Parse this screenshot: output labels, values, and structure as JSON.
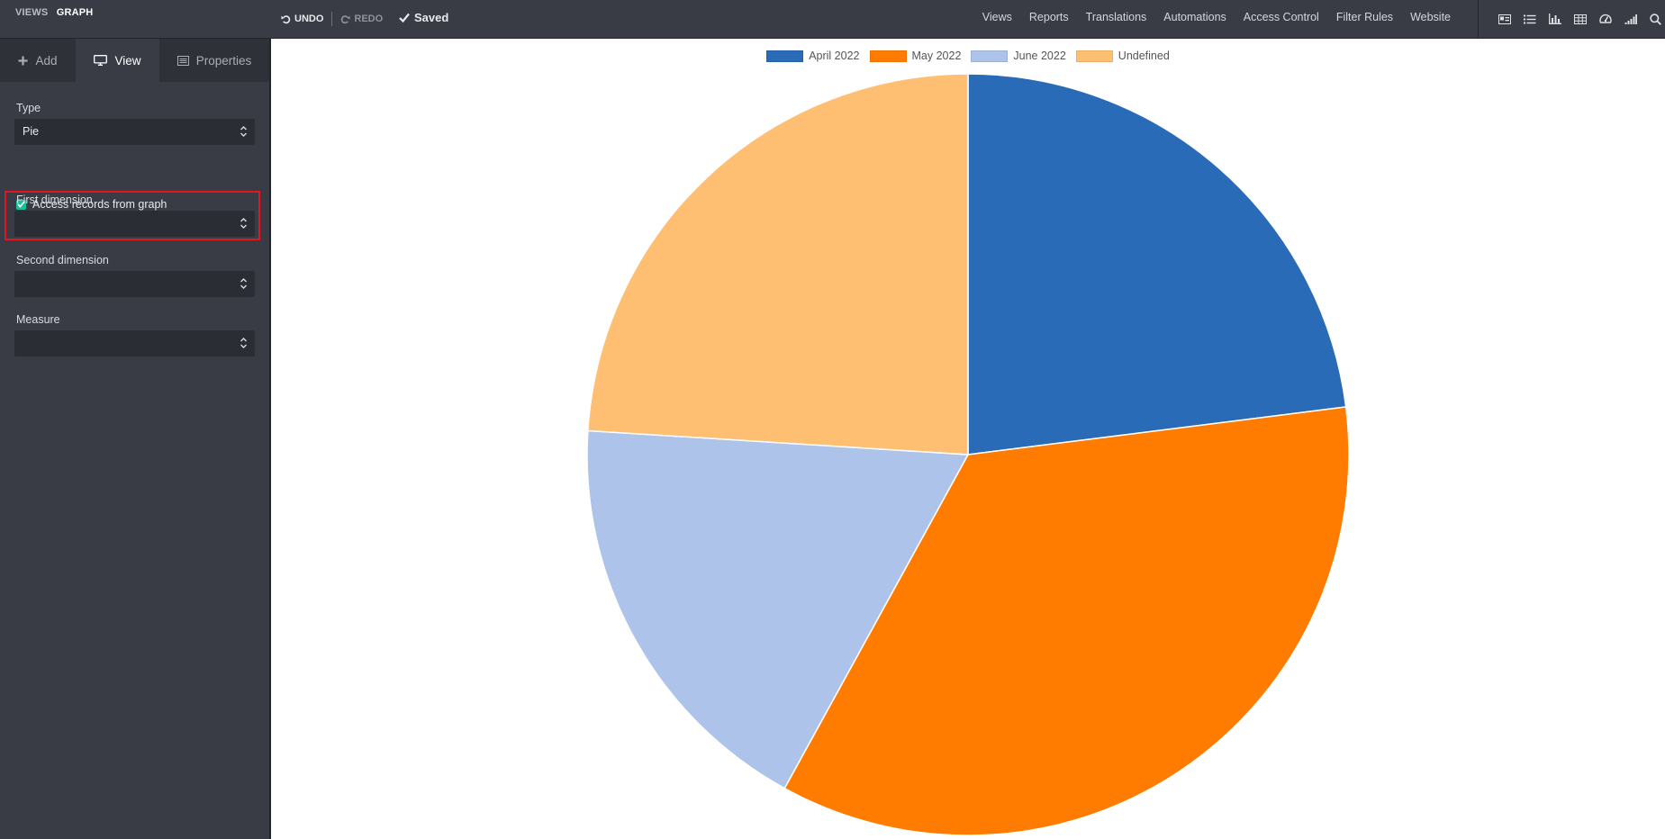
{
  "breadcrumb": {
    "views": "VIEWS",
    "current": "GRAPH"
  },
  "toolbar": {
    "undo": "UNDO",
    "redo": "REDO",
    "saved": "Saved"
  },
  "topnav": [
    "Views",
    "Reports",
    "Translations",
    "Automations",
    "Access Control",
    "Filter Rules",
    "Website"
  ],
  "view_switcher": [
    "form-view-icon",
    "list-view-icon",
    "graph-view-icon",
    "pivot-view-icon",
    "dashboard-view-icon",
    "cohort-view-icon",
    "search-icon"
  ],
  "sidebar": {
    "tabs": [
      {
        "label": "Add",
        "icon": "plus-icon"
      },
      {
        "label": "View",
        "icon": "monitor-icon",
        "active": true
      },
      {
        "label": "Properties",
        "icon": "list-icon"
      }
    ],
    "type_label": "Type",
    "type_value": "Pie",
    "access_label": "Access records from graph",
    "access_checked": true,
    "first_dim_label": "First dimension",
    "first_dim_value": "",
    "second_dim_label": "Second dimension",
    "second_dim_value": "",
    "measure_label": "Measure",
    "measure_value": ""
  },
  "colors": {
    "accent": "#1dbe96",
    "highlight": "#e4151e",
    "topbar": "#393c45"
  },
  "chart_data": {
    "type": "pie",
    "labels": [
      "April 2022",
      "May 2022",
      "June 2022",
      "Undefined"
    ],
    "values": [
      23,
      35,
      18,
      24
    ],
    "colors": [
      "#2a6bb8",
      "#ff7c00",
      "#aec3ea",
      "#ffbf73"
    ],
    "legend_position": "top"
  }
}
